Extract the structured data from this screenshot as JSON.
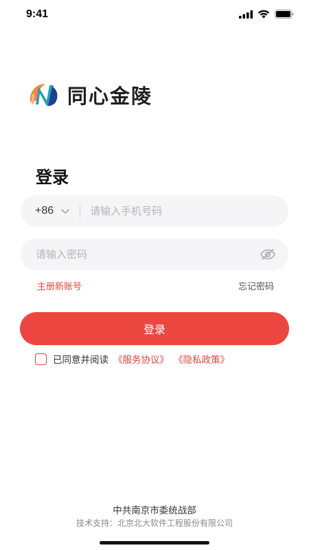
{
  "status_bar": {
    "time": "9:41",
    "icons": [
      "signal-icon",
      "wifi-icon",
      "battery-icon"
    ]
  },
  "brand": {
    "logo_text": "同心金陵",
    "colors": {
      "orange": "#f08a3c",
      "teal": "#2a9db8",
      "navy": "#1d3f8f"
    }
  },
  "login": {
    "title": "登录",
    "country_code": "+86",
    "phone_placeholder": "请输入手机号码",
    "password_placeholder": "请输入密码",
    "register_label": "主册新账号",
    "forgot_label": "忘记密码",
    "submit_label": "登录"
  },
  "agreement": {
    "prefix": "已同意并阅读",
    "service_link": "《服务协议》",
    "privacy_link": "《隐私政策》",
    "checked": false
  },
  "footer": {
    "organization": "中共南京市委统战部",
    "support": "技术支持：北京北大软件工程股份有限公司"
  },
  "accent_color": "#ec4640"
}
